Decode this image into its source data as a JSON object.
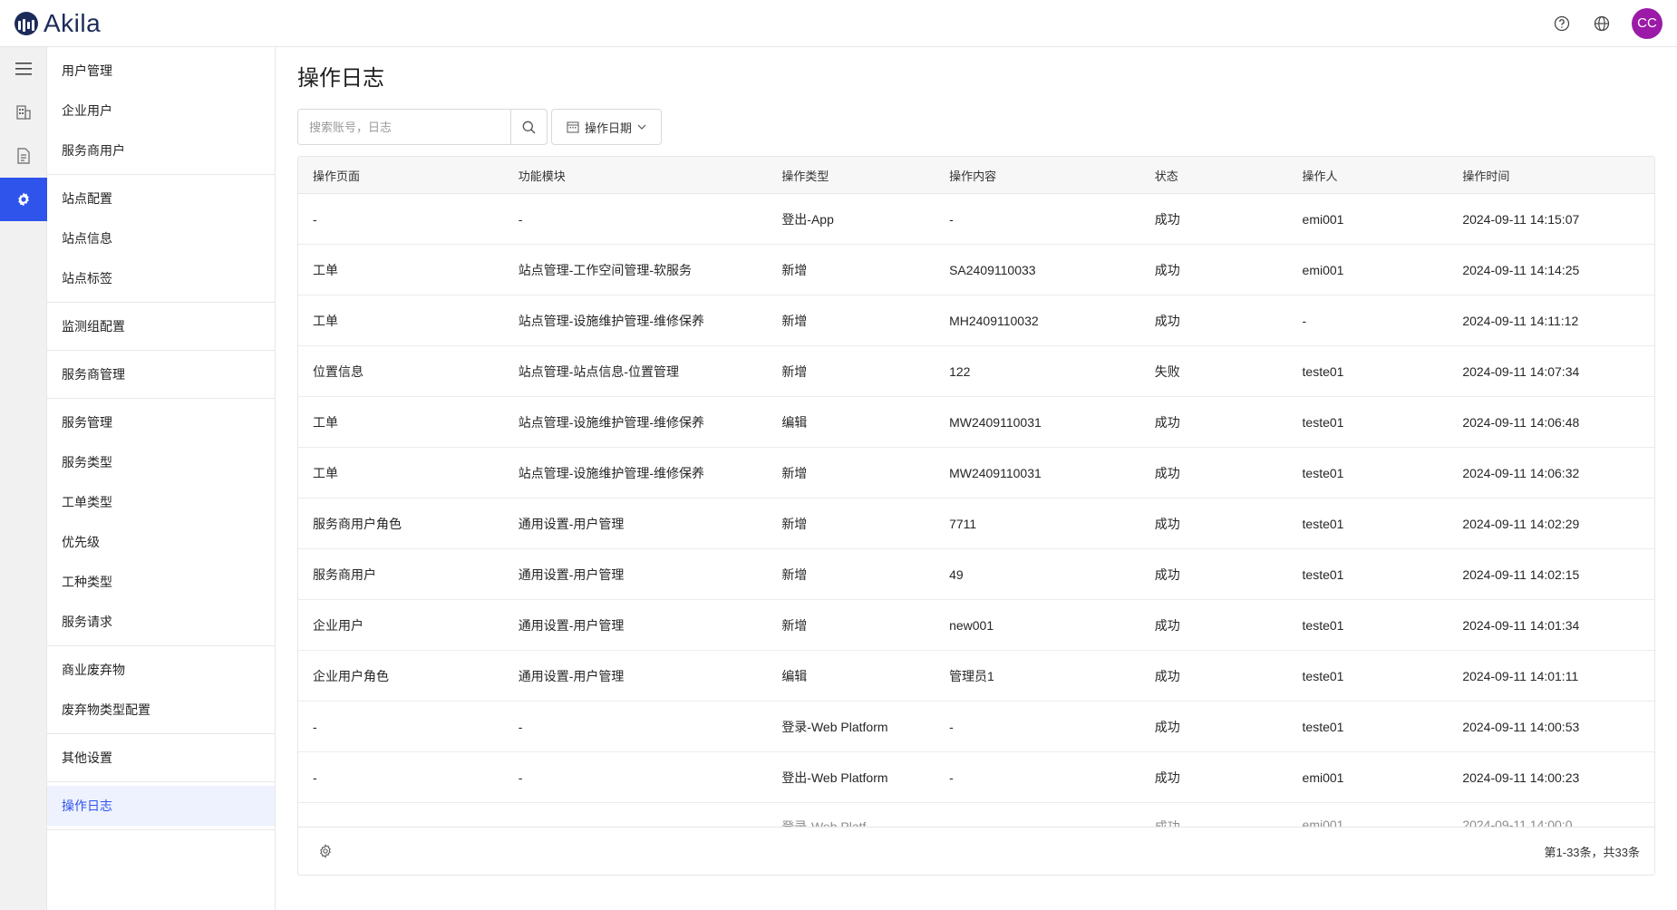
{
  "app": {
    "name": "Akila",
    "avatar_initials": "CC",
    "accent": "#2f54eb",
    "avatar_color": "#9b1aa8"
  },
  "topbar": {
    "icons": [
      "help-icon",
      "globe-icon"
    ]
  },
  "rail": {
    "items": [
      "menu-icon",
      "building-icon",
      "document-icon",
      "gear-icon"
    ],
    "active": "gear-icon"
  },
  "sidebar": {
    "groups": [
      {
        "head": "用户管理",
        "items": [
          "企业用户",
          "服务商用户"
        ]
      },
      {
        "head": "站点配置",
        "items": [
          "站点信息",
          "站点标签"
        ]
      },
      {
        "head": "监测组配置",
        "items": []
      },
      {
        "head": "服务商管理",
        "items": []
      },
      {
        "head": "服务管理",
        "items": [
          "服务类型",
          "工单类型",
          "优先级",
          "工种类型",
          "服务请求"
        ]
      },
      {
        "head": "商业废弃物",
        "items": [
          "废弃物类型配置"
        ]
      },
      {
        "head": "其他设置",
        "items": []
      },
      {
        "head": "操作日志",
        "items": [],
        "active": true
      }
    ]
  },
  "main": {
    "title": "操作日志",
    "search_placeholder": "搜索账号，日志",
    "date_filter": "操作日期",
    "columns": [
      "操作页面",
      "功能模块",
      "操作类型",
      "操作内容",
      "状态",
      "操作人",
      "操作时间"
    ],
    "rows": [
      [
        "-",
        "-",
        "登出-App",
        "-",
        "成功",
        "emi001",
        "2024-09-11 14:15:07"
      ],
      [
        "工单",
        "站点管理-工作空间管理-软服务",
        "新增",
        "SA2409110033",
        "成功",
        "emi001",
        "2024-09-11 14:14:25"
      ],
      [
        "工单",
        "站点管理-设施维护管理-维修保养",
        "新增",
        "MH2409110032",
        "成功",
        "-",
        "2024-09-11 14:11:12"
      ],
      [
        "位置信息",
        "站点管理-站点信息-位置管理",
        "新增",
        "122",
        "失败",
        "teste01",
        "2024-09-11 14:07:34"
      ],
      [
        "工单",
        "站点管理-设施维护管理-维修保养",
        "编辑",
        "MW2409110031",
        "成功",
        "teste01",
        "2024-09-11 14:06:48"
      ],
      [
        "工单",
        "站点管理-设施维护管理-维修保养",
        "新增",
        "MW2409110031",
        "成功",
        "teste01",
        "2024-09-11 14:06:32"
      ],
      [
        "服务商用户角色",
        "通用设置-用户管理",
        "新增",
        "7711",
        "成功",
        "teste01",
        "2024-09-11 14:02:29"
      ],
      [
        "服务商用户",
        "通用设置-用户管理",
        "新增",
        "49",
        "成功",
        "teste01",
        "2024-09-11 14:02:15"
      ],
      [
        "企业用户",
        "通用设置-用户管理",
        "新增",
        "new001",
        "成功",
        "teste01",
        "2024-09-11 14:01:34"
      ],
      [
        "企业用户角色",
        "通用设置-用户管理",
        "编辑",
        "管理员1",
        "成功",
        "teste01",
        "2024-09-11 14:01:11"
      ],
      [
        "-",
        "-",
        "登录-Web Platform",
        "-",
        "成功",
        "teste01",
        "2024-09-11 14:00:53"
      ],
      [
        "-",
        "-",
        "登出-Web Platform",
        "-",
        "成功",
        "emi001",
        "2024-09-11 14:00:23"
      ]
    ],
    "partial_row": [
      "",
      "",
      "登录-Web Platf",
      "",
      "成功",
      "emi001",
      "2024-09-11 14:00:0"
    ],
    "footer_count": "第1-33条，共33条"
  }
}
